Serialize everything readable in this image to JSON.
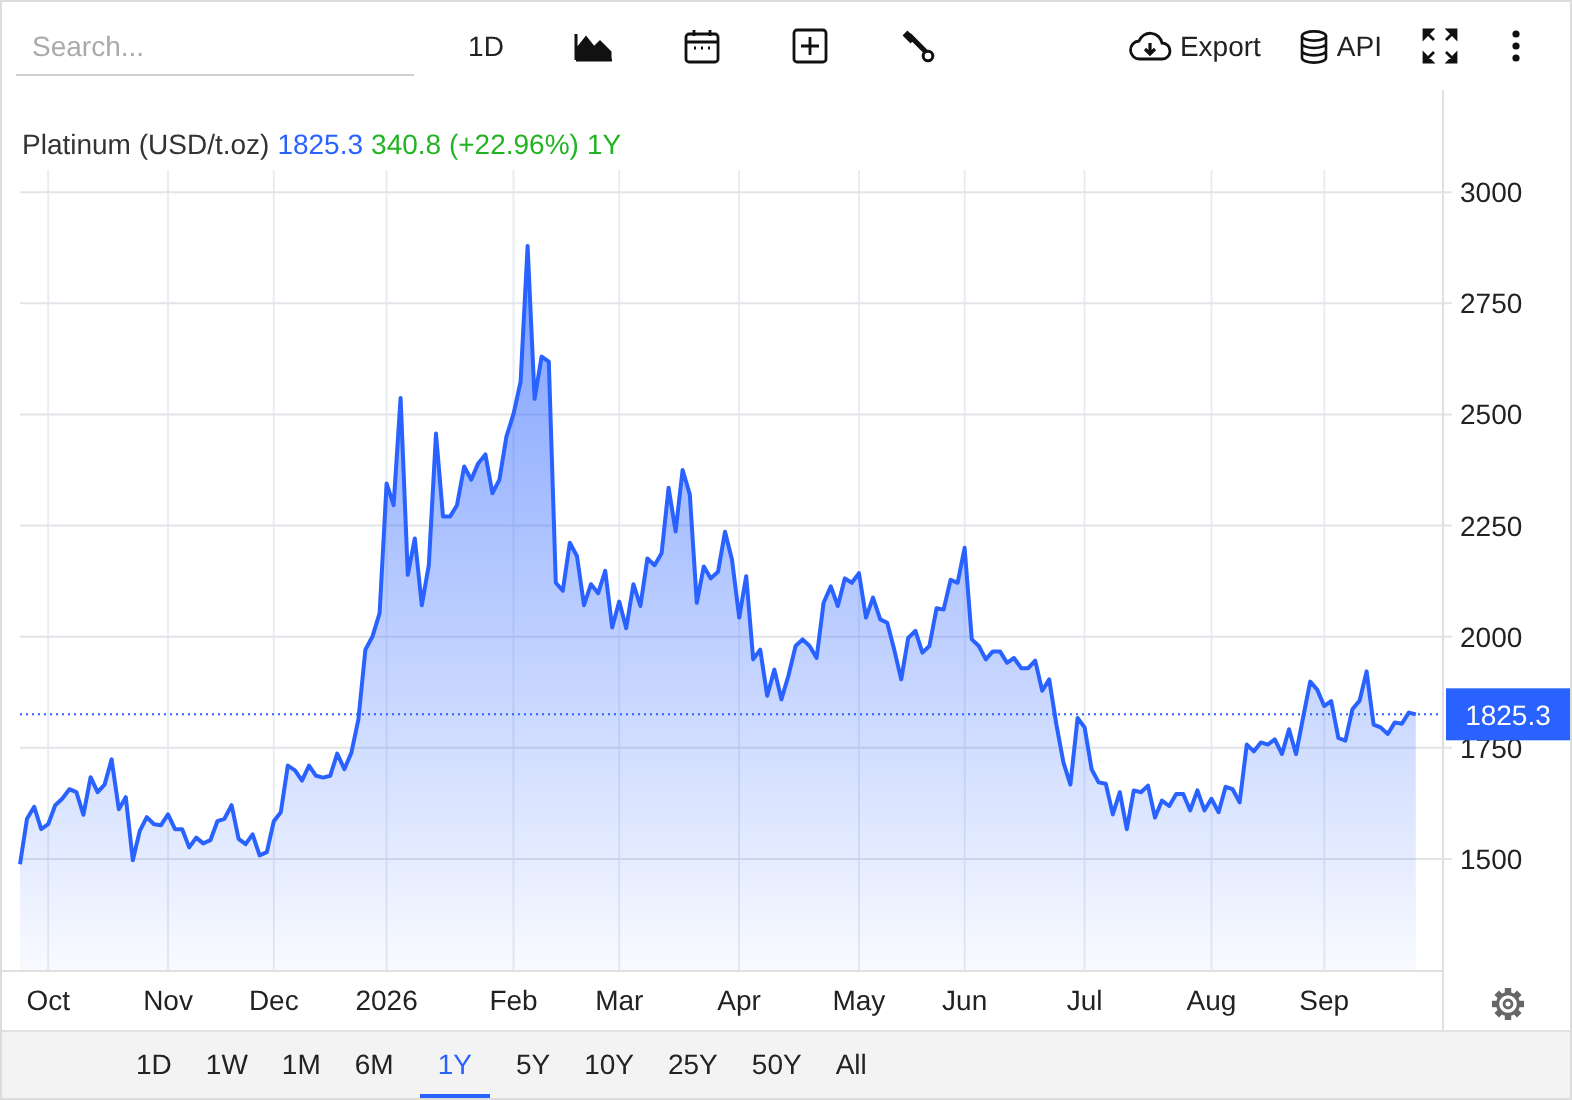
{
  "toolbar": {
    "search": {
      "placeholder": "Search..."
    },
    "interval": "1D",
    "export_label": "Export",
    "api_label": "API"
  },
  "legend": {
    "price": "1825.3",
    "change": "340.8 (+22.96%)",
    "period": "1Y"
  },
  "chart": {
    "chart_data": {
      "type": "area",
      "grid": true,
      "ref_lines": [
        {
          "axis": "y",
          "value": 1825.3,
          "label": "1825.3"
        }
      ],
      "categories": [
        null,
        null,
        null,
        null,
        "Oct",
        null,
        null,
        null,
        null,
        null,
        null,
        null,
        null,
        null,
        null,
        null,
        null,
        null,
        null,
        null,
        null,
        "Nov",
        null,
        null,
        null,
        null,
        null,
        null,
        null,
        null,
        null,
        null,
        null,
        null,
        null,
        null,
        "Dec",
        null,
        null,
        null,
        null,
        null,
        null,
        null,
        null,
        null,
        null,
        null,
        null,
        null,
        null,
        null,
        "2026",
        null,
        null,
        null,
        null,
        null,
        null,
        null,
        null,
        null,
        null,
        null,
        null,
        null,
        null,
        null,
        null,
        null,
        "Feb",
        null,
        null,
        null,
        null,
        null,
        null,
        null,
        null,
        null,
        null,
        null,
        null,
        null,
        null,
        "Mar",
        null,
        null,
        null,
        null,
        null,
        null,
        null,
        null,
        null,
        null,
        null,
        null,
        null,
        null,
        null,
        null,
        "Apr",
        null,
        null,
        null,
        null,
        null,
        null,
        null,
        null,
        null,
        null,
        null,
        null,
        null,
        null,
        null,
        null,
        "May",
        null,
        null,
        null,
        null,
        null,
        null,
        null,
        null,
        null,
        null,
        null,
        null,
        null,
        null,
        "Jun",
        null,
        null,
        null,
        null,
        null,
        null,
        null,
        null,
        null,
        null,
        null,
        null,
        null,
        null,
        null,
        null,
        "Jul",
        null,
        null,
        null,
        null,
        null,
        null,
        null,
        null,
        null,
        null,
        null,
        null,
        null,
        null,
        null,
        null,
        null,
        "Aug",
        null,
        null,
        null,
        null,
        null,
        null,
        null,
        null,
        null,
        null,
        null,
        null,
        null,
        null,
        null,
        "Sep",
        null,
        null,
        null,
        null,
        null,
        null,
        null,
        null,
        null,
        null,
        null,
        null,
        null
      ],
      "series": [
        {
          "name": "Platinum (USD/t.oz)",
          "color": "#2962ff",
          "values": [
            1488,
            1590,
            1617,
            1567,
            1578,
            1621,
            1635,
            1657,
            1650,
            1599,
            1684,
            1650,
            1667,
            1724,
            1612,
            1639,
            1497,
            1563,
            1594,
            1578,
            1576,
            1600,
            1567,
            1567,
            1526,
            1548,
            1535,
            1542,
            1585,
            1590,
            1621,
            1545,
            1533,
            1555,
            1508,
            1515,
            1585,
            1605,
            1710,
            1699,
            1676,
            1710,
            1687,
            1683,
            1687,
            1737,
            1702,
            1739,
            1814,
            1971,
            2001,
            2053,
            2345,
            2296,
            2537,
            2139,
            2221,
            2071,
            2161,
            2457,
            2270,
            2270,
            2296,
            2383,
            2353,
            2390,
            2410,
            2323,
            2353,
            2450,
            2502,
            2574,
            2879,
            2535,
            2630,
            2619,
            2121,
            2103,
            2211,
            2181,
            2071,
            2118,
            2098,
            2148,
            2021,
            2079,
            2019,
            2118,
            2069,
            2176,
            2161,
            2188,
            2335,
            2237,
            2375,
            2320,
            2076,
            2158,
            2131,
            2146,
            2236,
            2173,
            2043,
            2136,
            1949,
            1971,
            1867,
            1926,
            1859,
            1912,
            1979,
            1994,
            1979,
            1952,
            2076,
            2113,
            2069,
            2131,
            2121,
            2143,
            2043,
            2088,
            2039,
            2031,
            1971,
            1904,
            1997,
            2013,
            1964,
            1979,
            2064,
            2061,
            2128,
            2121,
            2200,
            1994,
            1979,
            1949,
            1967,
            1967,
            1941,
            1952,
            1929,
            1929,
            1946,
            1878,
            1904,
            1802,
            1717,
            1667,
            1817,
            1796,
            1702,
            1672,
            1669,
            1600,
            1650,
            1567,
            1654,
            1650,
            1665,
            1593,
            1631,
            1619,
            1646,
            1646,
            1609,
            1654,
            1609,
            1635,
            1605,
            1662,
            1657,
            1627,
            1757,
            1742,
            1762,
            1757,
            1769,
            1736,
            1792,
            1736,
            1817,
            1899,
            1881,
            1844,
            1855,
            1772,
            1766,
            1837,
            1856,
            1922,
            1802,
            1796,
            1781,
            1807,
            1804,
            1829,
            1825.3
          ]
        }
      ],
      "ylim": [
        1250,
        3050
      ],
      "yticks": [
        1500,
        1750,
        2000,
        2250,
        2500,
        2750,
        3000
      ]
    }
  },
  "ranges": [
    {
      "label": "1D",
      "selected": false
    },
    {
      "label": "1W",
      "selected": false
    },
    {
      "label": "1M",
      "selected": false
    },
    {
      "label": "6M",
      "selected": false
    },
    {
      "label": "1Y",
      "selected": true
    },
    {
      "label": "5Y",
      "selected": false
    },
    {
      "label": "10Y",
      "selected": false
    },
    {
      "label": "25Y",
      "selected": false
    },
    {
      "label": "50Y",
      "selected": false
    },
    {
      "label": "All",
      "selected": false
    }
  ]
}
